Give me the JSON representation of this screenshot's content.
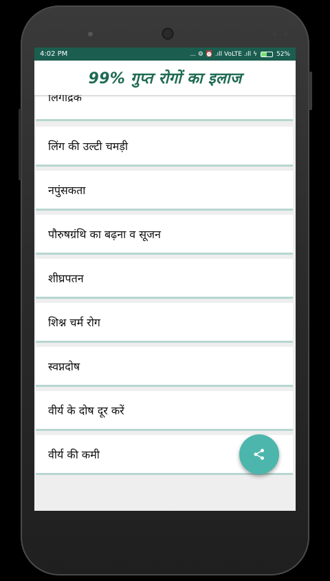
{
  "status": {
    "time": "4:02 PM",
    "indicators": "... ⚙ ⏰ .ıll VoLTE .ıll ϟ",
    "battery_pct": "52%",
    "battery_level": 0.52
  },
  "appbar": {
    "title": "99% गुप्त रोगों का इलाज"
  },
  "items": [
    "लिंगोद्रेक",
    "लिंग की उल्टी चमड़ी",
    "नपुंसकता",
    "पौरुषग्रंथि का बढ़ना व सूजन",
    "शीघ्रपतन",
    "शिश्न चर्म रोग",
    "स्वप्नदोष",
    "वीर्य के दोष दूर करें",
    "वीर्य की कमी"
  ],
  "fab": {
    "icon": "share-icon"
  },
  "colors": {
    "accent": "#4db6ac",
    "title": "#1e6a52",
    "statusbar": "#1b5e50",
    "divider": "#b7d6d0"
  }
}
